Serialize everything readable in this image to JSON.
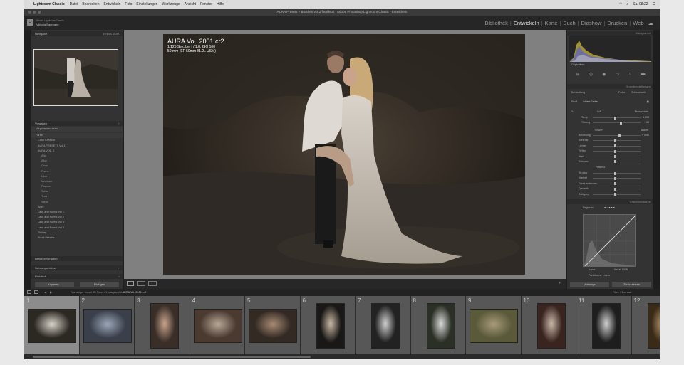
{
  "menubar": {
    "app": "Lightroom Classic",
    "items": [
      "Datei",
      "Bearbeiten",
      "Entwickeln",
      "Foto",
      "Einstellungen",
      "Werkzeuge",
      "Ansicht",
      "Fenster",
      "Hilfe"
    ],
    "clock": "Sa. 08:22"
  },
  "window_title": "AURA Presets + Brushes Vol.2 final kcat - Adobe Photoshop Lightroom Classic - Entwickeln",
  "identity": {
    "line1": "Adobe Lightroom Classic",
    "line2": "Viktoria Baumann"
  },
  "modules": [
    "Bibliothek",
    "Entwickeln",
    "Karte",
    "Buch",
    "Diashow",
    "Drucken",
    "Web"
  ],
  "active_module": "Entwickeln",
  "left_panel": {
    "navigator_label": "Navigator",
    "navigator_zoom": "Einpas.  Ausf.",
    "presets_label": "Vorgaben",
    "preset_items": [
      {
        "label": "Vorgabe benutzen",
        "kind": "group"
      },
      {
        "label": "Farbe",
        "kind": "group"
      },
      {
        "label": "Color Creative",
        "kind": "item"
      },
      {
        "label": "AURA PRESETS Vol 1",
        "kind": "item"
      },
      {
        "label": "AURA VOL. 2",
        "kind": "item"
      },
      {
        "label": "Afar",
        "kind": "sub"
      },
      {
        "label": "Alba",
        "kind": "sub"
      },
      {
        "label": "Coco",
        "kind": "sub"
      },
      {
        "label": "Fuchs",
        "kind": "sub"
      },
      {
        "label": "Libre",
        "kind": "sub"
      },
      {
        "label": "Meridian",
        "kind": "sub"
      },
      {
        "label": "Pavone",
        "kind": "sub"
      },
      {
        "label": "Sahra",
        "kind": "sub"
      },
      {
        "label": "Tesa",
        "kind": "sub"
      },
      {
        "label": "Venia",
        "kind": "sub"
      },
      {
        "label": "Apex",
        "kind": "item"
      },
      {
        "label": "Lake and Forest Vol 1",
        "kind": "item"
      },
      {
        "label": "Lake and Forest Vol 2",
        "kind": "item"
      },
      {
        "label": "Lake and Forest Vol 3",
        "kind": "item"
      },
      {
        "label": "Lake and Forest Vol 4",
        "kind": "item"
      },
      {
        "label": "Skillery",
        "kind": "item"
      },
      {
        "label": "Stock Presets",
        "kind": "item"
      }
    ],
    "footer_rows": [
      "Benutzervorgaben",
      "Schnappschüsse",
      "Protokoll"
    ],
    "copy_button": "Kopieren...",
    "paste_button": "Einfügen"
  },
  "photo": {
    "filename": "AURA Vol. 2001.cr2",
    "exif_line1": "1/125 Sek. bei f / 1,8, ISO 100",
    "exif_line2": "50 mm (EF 50mm f/1.2L USM)"
  },
  "right_panel": {
    "histogram_label": "Histogramm",
    "original_photo": "Originalfoto",
    "basic_label": "Grundeinstellungen",
    "treatment": "Behandlung",
    "color": "Farbe",
    "bw": "Schwarzweiß",
    "profile_label": "Profil",
    "profile_value": "Adobe Farbe",
    "wb_label": "WA",
    "wb_value": "Benutzerdef.",
    "temp_label": "Temp",
    "temp_value": "8.200",
    "tint_label": "Tönung",
    "tint_value": "+ 12",
    "tone_label": "Tonwert",
    "auto_label": "Autom.",
    "tone_rows": [
      "Belichtung",
      "Kontrast",
      "Lichter",
      "Tiefen",
      "Weiß",
      "Schwarz"
    ],
    "exposure_value": "+ 0,90",
    "presence_label": "Präsenz",
    "presence_rows": [
      "Struktur",
      "Klarheit",
      "Dunst entfernen",
      "Dynamik",
      "Sättigung"
    ],
    "curve_label": "Gradationskurve",
    "curve_mode": "Regionen",
    "curve_footer_left": "Kanal",
    "channel_label": "Kanal: RGB",
    "point_curve": "Punktkurve: Linear",
    "prev_button": "Vorherige",
    "reset_button": "Zurücksetzen"
  },
  "filmstrip": {
    "path_prefix": "Vorheriger Import",
    "count_text": "25 Fotos / 1 ausgewählt",
    "selected_file": "AURA Vol. 2001.cr2",
    "filter_label": "Filter:",
    "filter_value": "Filter aus",
    "frames": [
      "1",
      "2",
      "3",
      "4",
      "5",
      "6",
      "7",
      "8",
      "9",
      "10",
      "11",
      "12"
    ]
  }
}
